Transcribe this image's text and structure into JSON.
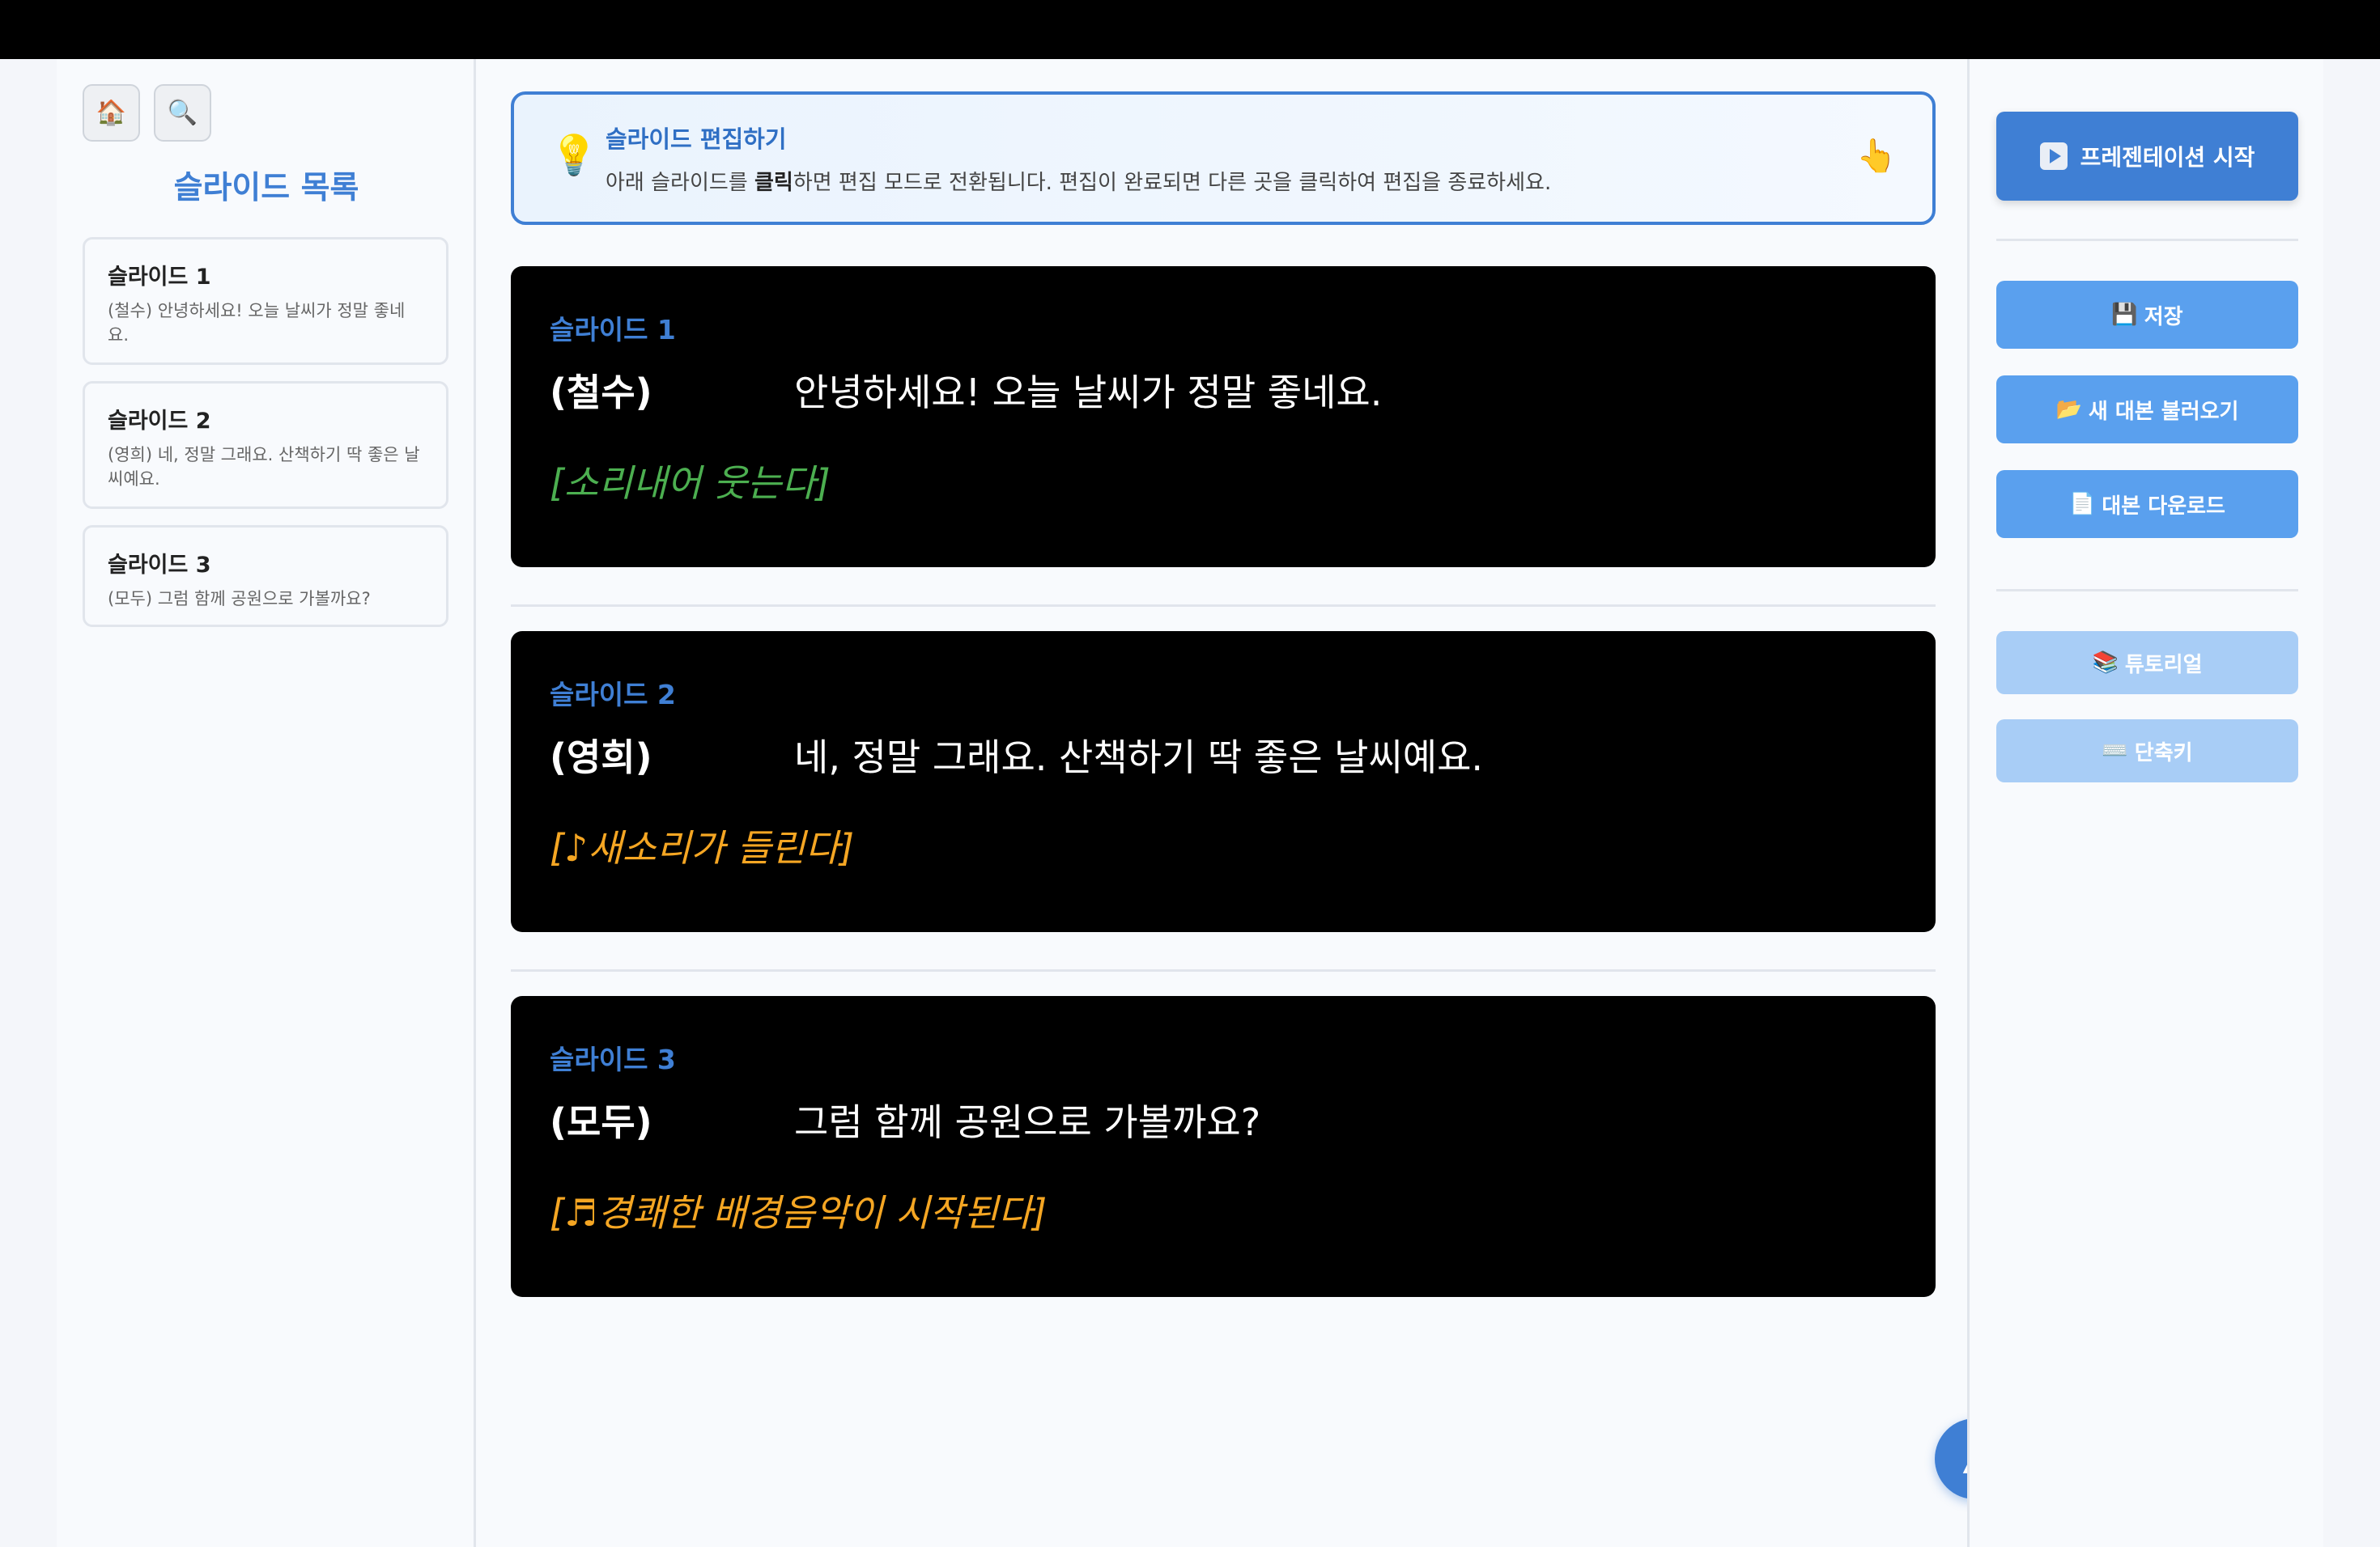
{
  "sidebar": {
    "home_icon": "🏠",
    "search_icon": "🔍",
    "title": "슬라이드 목록",
    "items": [
      {
        "title": "슬라이드 1",
        "text": "(철수) 안녕하세요! 오늘 날씨가 정말 좋네요."
      },
      {
        "title": "슬라이드 2",
        "text": "(영희) 네, 정말 그래요. 산책하기 딱 좋은 날씨예요."
      },
      {
        "title": "슬라이드 3",
        "text": "(모두) 그럼 함께 공원으로 가볼까요?"
      }
    ]
  },
  "hint": {
    "bulb_icon": "💡",
    "title": "슬라이드 편집하기",
    "text_before": "아래 슬라이드를 ",
    "text_bold": "클릭",
    "text_after": "하면 편집 모드로 전환됩니다. 편집이 완료되면 다른 곳을 클릭하여 편집을 종료하세요.",
    "pointer_icon": "👆"
  },
  "slides": [
    {
      "number": "슬라이드 1",
      "speaker": "(철수)",
      "line": "안녕하세요! 오늘 날씨가 정말 좋네요.",
      "stage": "[소리내어 웃는다]",
      "stage_color": "#4caf50"
    },
    {
      "number": "슬라이드 2",
      "speaker": "(영희)",
      "line": "네, 정말 그래요. 산책하기 딱 좋은 날씨예요.",
      "stage": "[♪새소리가 들린다]",
      "stage_color": "#f5a623"
    },
    {
      "number": "슬라이드 3",
      "speaker": "(모두)",
      "line": "그럼 함께 공원으로 가볼까요?",
      "stage": "[♬경쾌한 배경음악이 시작된다]",
      "stage_color": "#f5a623"
    }
  ],
  "scroll_top_icon": "▲",
  "toolbar": {
    "start_presentation": "프레젠테이션 시작",
    "save_icon": "💾",
    "save": "저장",
    "load_icon": "📂",
    "load": "새 대본 불러오기",
    "download_icon": "📄",
    "download": "대본 다운로드",
    "tutorial_icon": "📚",
    "tutorial": "튜토리얼",
    "shortcuts_icon": "⌨️",
    "shortcuts": "단축키"
  }
}
